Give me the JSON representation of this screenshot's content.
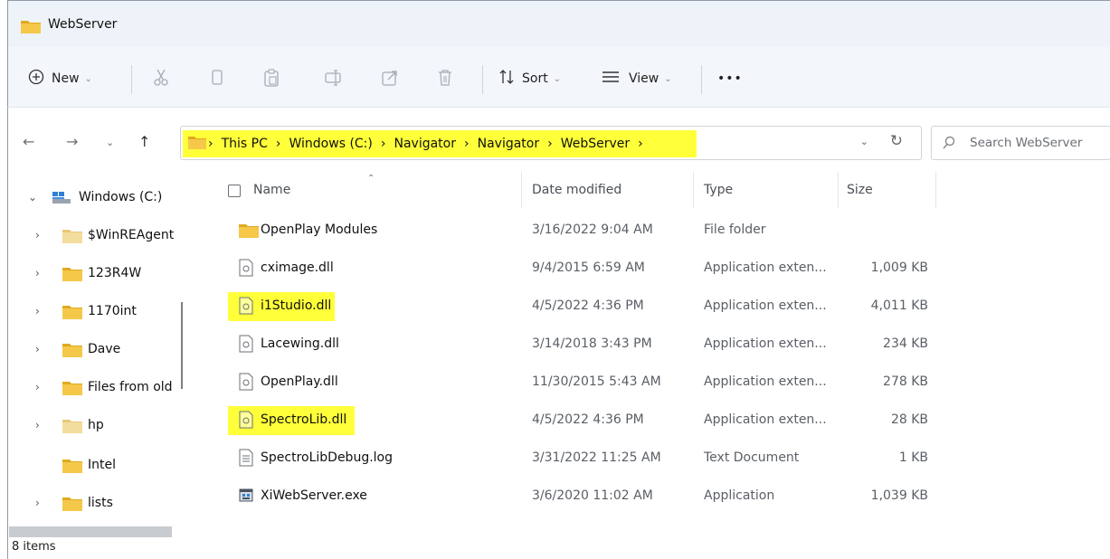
{
  "window": {
    "title": "WebServer"
  },
  "toolbar": {
    "new_label": "New",
    "sort_label": "Sort",
    "view_label": "View",
    "more_label": "•••"
  },
  "address": {
    "crumbs": [
      "This PC",
      "Windows (C:)",
      "Navigator",
      "Navigator",
      "WebServer"
    ]
  },
  "search": {
    "placeholder": "Search WebServer"
  },
  "sidebar": {
    "items": [
      {
        "label": "Windows (C:)",
        "expander": "down"
      },
      {
        "label": "$WinREAgent",
        "expander": "right"
      },
      {
        "label": "123R4W",
        "expander": "right"
      },
      {
        "label": "1170int",
        "expander": "right"
      },
      {
        "label": "Dave",
        "expander": "right"
      },
      {
        "label": "Files from old",
        "expander": "right"
      },
      {
        "label": "hp",
        "expander": "right"
      },
      {
        "label": "Intel",
        "expander": "none"
      },
      {
        "label": "lists",
        "expander": "right"
      }
    ]
  },
  "columns": {
    "name": "Name",
    "date": "Date modified",
    "type": "Type",
    "size": "Size"
  },
  "files": [
    {
      "name": "OpenPlay Modules",
      "date": "3/16/2022 9:04 AM",
      "type": "File folder",
      "size": "",
      "icon": "folder-icon",
      "highlight": false
    },
    {
      "name": "cximage.dll",
      "date": "9/4/2015 6:59 AM",
      "type": "Application exten...",
      "size": "1,009 KB",
      "icon": "dll-file-icon",
      "highlight": false
    },
    {
      "name": "i1Studio.dll",
      "date": "4/5/2022 4:36 PM",
      "type": "Application exten...",
      "size": "4,011 KB",
      "icon": "dll-file-icon",
      "highlight": true
    },
    {
      "name": "Lacewing.dll",
      "date": "3/14/2018 3:43 PM",
      "type": "Application exten...",
      "size": "234 KB",
      "icon": "dll-file-icon",
      "highlight": false
    },
    {
      "name": "OpenPlay.dll",
      "date": "11/30/2015 5:43 AM",
      "type": "Application exten...",
      "size": "278 KB",
      "icon": "dll-file-icon",
      "highlight": false
    },
    {
      "name": "SpectroLib.dll",
      "date": "4/5/2022 4:36 PM",
      "type": "Application exten...",
      "size": "28 KB",
      "icon": "dll-file-icon",
      "highlight": true
    },
    {
      "name": "SpectroLibDebug.log",
      "date": "3/31/2022 11:25 AM",
      "type": "Text Document",
      "size": "1 KB",
      "icon": "text-file-icon",
      "highlight": false
    },
    {
      "name": "XiWebServer.exe",
      "date": "3/6/2020 11:02 AM",
      "type": "Application",
      "size": "1,039 KB",
      "icon": "exe-file-icon",
      "highlight": false
    }
  ],
  "status": {
    "items_text": "8 items"
  },
  "colors": {
    "highlight": "#ffff3a",
    "folder": "#f2c94c",
    "folder_dark": "#e0a91f"
  }
}
